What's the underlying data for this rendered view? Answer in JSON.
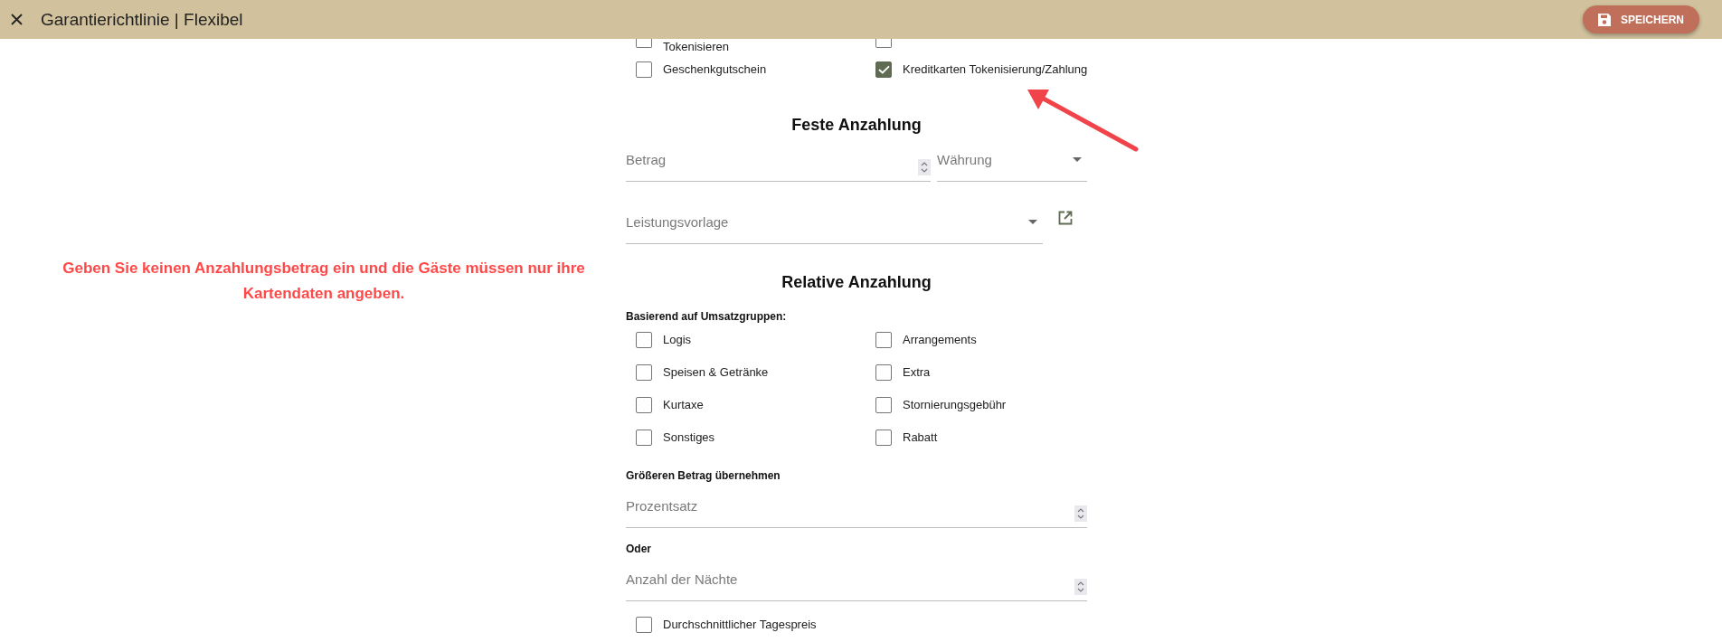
{
  "header": {
    "title": "Garantierichtlinie | Flexibel",
    "save_button": "SPEICHERN"
  },
  "note": "Geben Sie keinen Anzahlungsbetrag ein und die Gäste müssen nur ihre Kartendaten angeben.",
  "payment_options": [
    {
      "label": "Tokenisieren",
      "checked": false
    },
    {
      "checked": false
    },
    {
      "label": "Geschenkgutschein",
      "checked": false
    },
    {
      "label": "Kreditkarten Tokenisierung/Zahlung",
      "checked": true
    }
  ],
  "fixed_deposit": {
    "title": "Feste Anzahlung",
    "amount": {
      "placeholder": "Betrag"
    },
    "currency": {
      "placeholder": "Währung"
    },
    "service_template": {
      "placeholder": "Leistungsvorlage"
    }
  },
  "relative_deposit": {
    "title": "Relative Anzahlung",
    "groups_label": "Basierend auf Umsatzgruppen:",
    "groups": [
      {
        "label": "Logis",
        "checked": false
      },
      {
        "label": "Arrangements",
        "checked": false
      },
      {
        "label": "Speisen & Getränke",
        "checked": false
      },
      {
        "label": "Extra",
        "checked": false
      },
      {
        "label": "Kurtaxe",
        "checked": false
      },
      {
        "label": "Stornierungsgebühr",
        "checked": false
      },
      {
        "label": "Sonstiges",
        "checked": false
      },
      {
        "label": "Rabatt",
        "checked": false
      }
    ],
    "greater_label": "Größeren Betrag übernehmen",
    "percentage": {
      "placeholder": "Prozentsatz"
    },
    "or_label": "Oder",
    "nights": {
      "placeholder": "Anzahl der Nächte"
    },
    "average_rate": {
      "label": "Durchschnittlicher Tagespreis",
      "checked": false
    }
  }
}
